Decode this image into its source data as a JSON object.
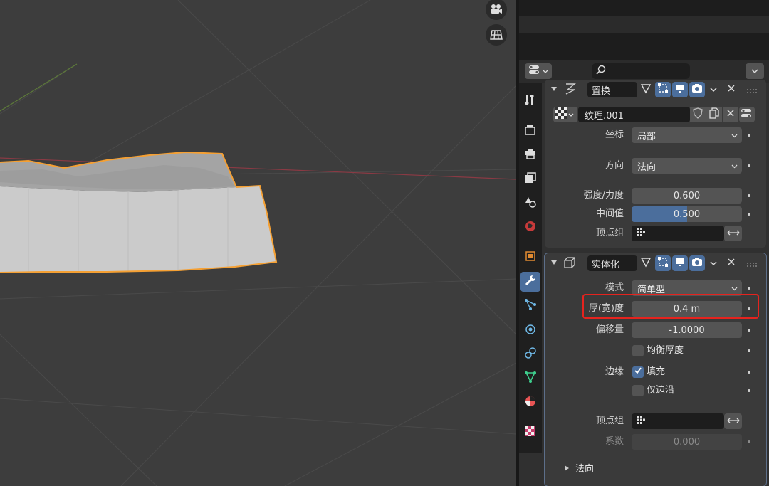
{
  "search": {
    "placeholder": ""
  },
  "tabs": [
    {
      "icon": "tool-icon"
    },
    {
      "icon": "render-icon"
    },
    {
      "icon": "output-icon"
    },
    {
      "icon": "view-layer-icon"
    },
    {
      "icon": "scene-icon"
    },
    {
      "icon": "world-icon"
    },
    {
      "icon": "object-icon"
    },
    {
      "icon": "modifier-wrench-icon",
      "active": true
    },
    {
      "icon": "particles-icon"
    },
    {
      "icon": "physics-icon"
    },
    {
      "icon": "constraints-icon"
    },
    {
      "icon": "data-icon"
    },
    {
      "icon": "material-icon"
    },
    {
      "icon": "texture-icon"
    }
  ],
  "displace": {
    "name": "置换",
    "texture_name": "纹理.001",
    "coords_label": "坐标",
    "coords_value": "局部",
    "direction_label": "方向",
    "direction_value": "法向",
    "strength_label": "强度/力度",
    "strength_value": "0.600",
    "midlevel_label": "中间值",
    "midlevel_value": "0.500",
    "midlevel_fraction": 0.5,
    "vgroup_label": "顶点组"
  },
  "solidify": {
    "name": "实体化",
    "mode_label": "模式",
    "mode_value": "简单型",
    "thickness_label": "厚(宽)度",
    "thickness_value": "0.4 m",
    "offset_label": "偏移量",
    "offset_value": "-1.0000",
    "even_label": "均衡厚度",
    "even_checked": false,
    "rim_label": "边缘",
    "fill_label": "填充",
    "fill_checked": true,
    "rim_only_label": "仅边沿",
    "rim_only_checked": false,
    "vgroup_label": "顶点组",
    "factor_label": "系数",
    "factor_value": "0.000",
    "normals_label": "法向"
  },
  "colors": {
    "accent": "#4b6e9c",
    "selection_outline": "#f5a033",
    "highlight_box": "#e5231e"
  }
}
